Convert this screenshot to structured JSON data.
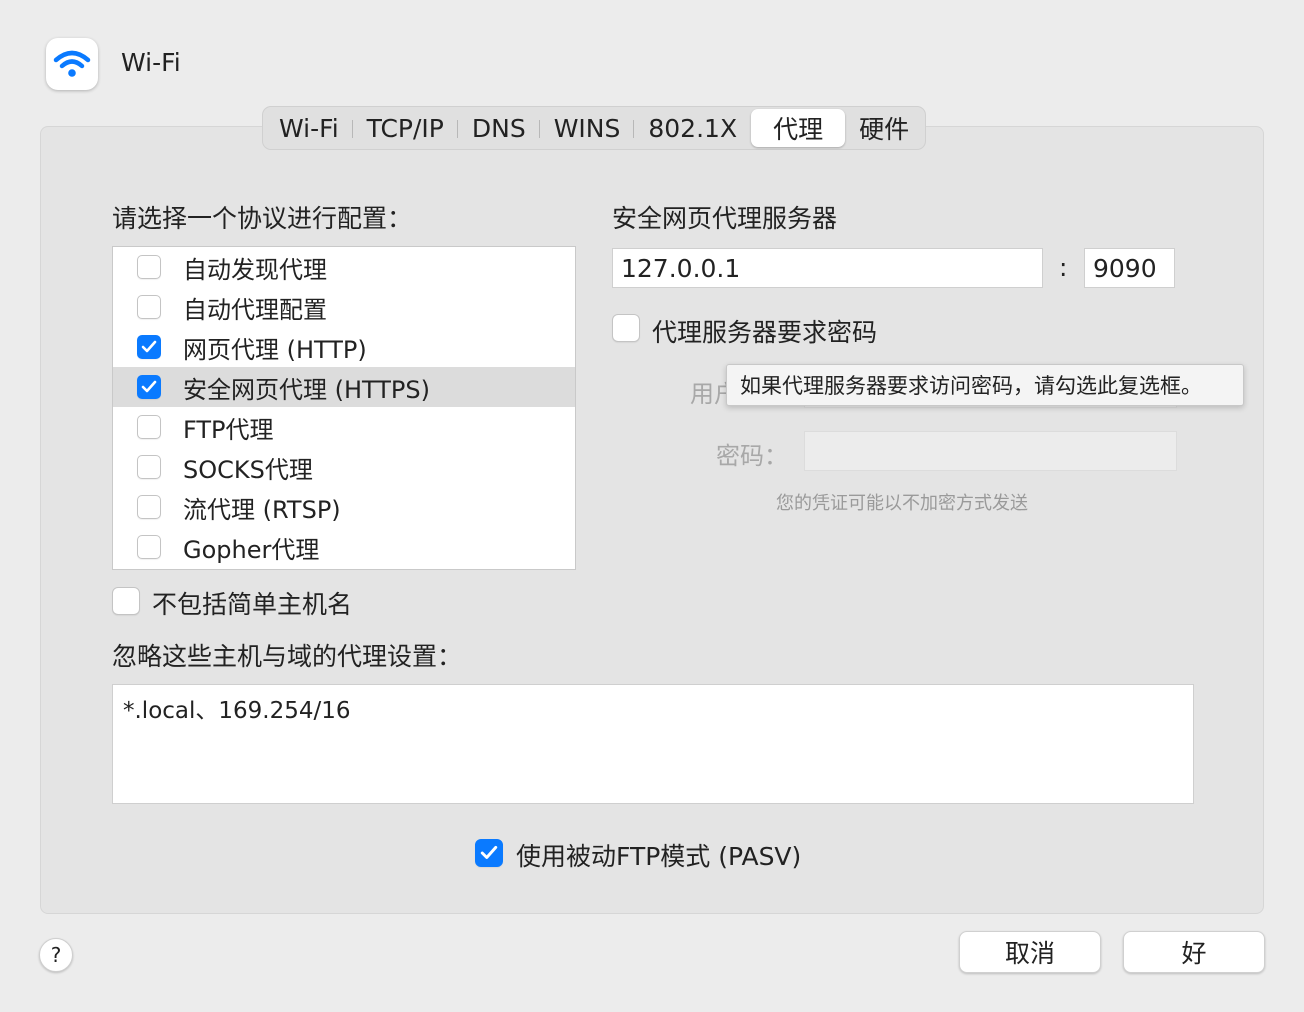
{
  "window": {
    "title": "Wi-Fi",
    "icon": "wifi-icon"
  },
  "tabs": [
    {
      "label": "Wi-Fi",
      "active": false
    },
    {
      "label": "TCP/IP",
      "active": false
    },
    {
      "label": "DNS",
      "active": false
    },
    {
      "label": "WINS",
      "active": false
    },
    {
      "label": "802.1X",
      "active": false
    },
    {
      "label": "代理",
      "active": true
    },
    {
      "label": "硬件",
      "active": false
    }
  ],
  "protocols": {
    "heading": "请选择一个协议进行配置：",
    "items": [
      {
        "label": "自动发现代理",
        "checked": false,
        "selected": false
      },
      {
        "label": "自动代理配置",
        "checked": false,
        "selected": false
      },
      {
        "label": "网页代理 (HTTP)",
        "checked": true,
        "selected": false
      },
      {
        "label": "安全网页代理 (HTTPS)",
        "checked": true,
        "selected": true
      },
      {
        "label": "FTP代理",
        "checked": false,
        "selected": false
      },
      {
        "label": "SOCKS代理",
        "checked": false,
        "selected": false
      },
      {
        "label": "流代理 (RTSP)",
        "checked": false,
        "selected": false
      },
      {
        "label": "Gopher代理",
        "checked": false,
        "selected": false
      }
    ]
  },
  "server": {
    "heading": "安全网页代理服务器",
    "host": "127.0.0.1",
    "colon": ":",
    "port": "9090",
    "requires_password_label": "代理服务器要求密码",
    "requires_password_checked": false,
    "username_label": "用户",
    "password_label": "密码：",
    "note": "您的凭证可能以不加密方式发送",
    "tooltip": "如果代理服务器要求访问密码，请勾选此复选框。"
  },
  "exclude_simple": {
    "label": "不包括简单主机名",
    "checked": false
  },
  "bypass": {
    "heading": "忽略这些主机与域的代理设置：",
    "value": "*.local、169.254/16"
  },
  "pasv": {
    "label": "使用被动FTP模式 (PASV)",
    "checked": true
  },
  "buttons": {
    "help": "?",
    "cancel": "取消",
    "ok": "好"
  },
  "colors": {
    "accent": "#0a7aff",
    "selected_row": "#dcdcdc"
  }
}
